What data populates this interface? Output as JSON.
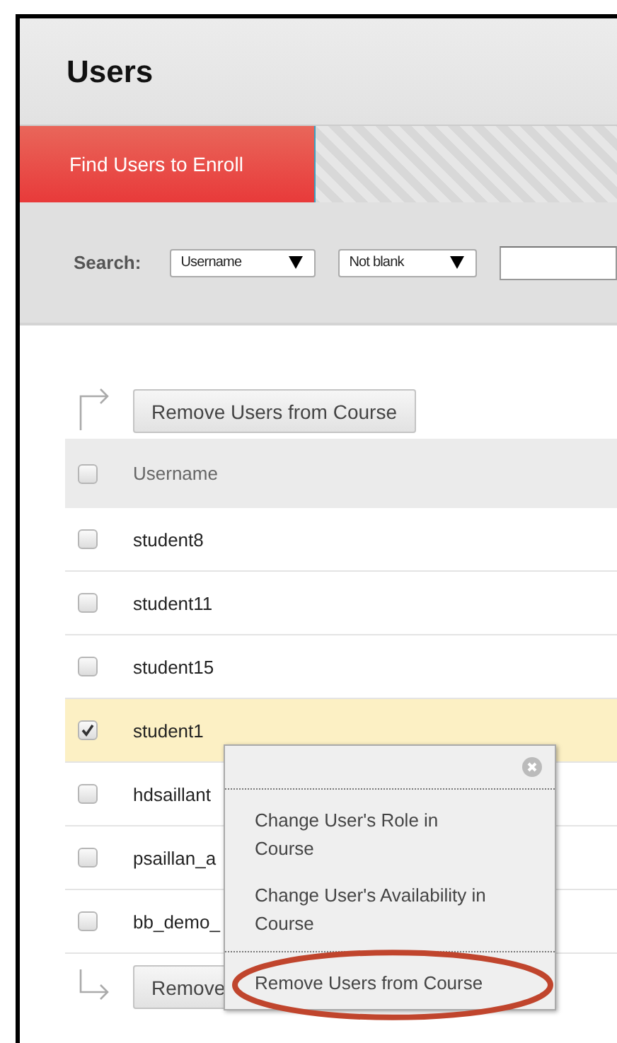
{
  "page": {
    "title": "Users"
  },
  "tabs": [
    {
      "label": "Find Users to Enroll",
      "selected": true
    }
  ],
  "search": {
    "label": "Search:",
    "field": "Username",
    "operator": "Not blank"
  },
  "top_action": {
    "label": "Remove Users from Course"
  },
  "table": {
    "header_checked": false,
    "columns": [
      "Username"
    ],
    "rows": [
      {
        "username": "student8",
        "checked": false
      },
      {
        "username": "student11",
        "checked": false
      },
      {
        "username": "student15",
        "checked": false
      },
      {
        "username": "student1",
        "checked": true
      },
      {
        "username": "hdsaillant",
        "checked": false
      },
      {
        "username": "psaillan_a",
        "checked": false
      },
      {
        "username": "bb_demo_",
        "checked": false
      }
    ]
  },
  "bottom_action": {
    "label": "Remove"
  },
  "context_menu": {
    "items": [
      {
        "label": "Change User's Role in Course",
        "highlighted": false
      },
      {
        "label": "Change User's Availability in Course",
        "highlighted": false
      },
      {
        "label": "Remove Users from Course",
        "highlighted": true
      }
    ]
  }
}
